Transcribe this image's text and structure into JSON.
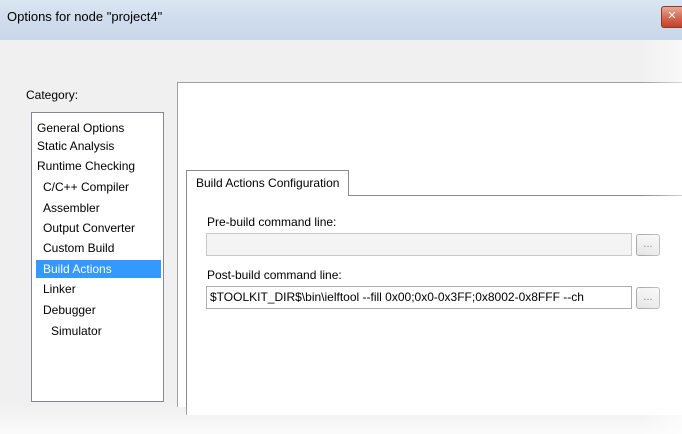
{
  "window": {
    "title": "Options for node \"project4\"",
    "close_glyph": "✕"
  },
  "category": {
    "label": "Category:",
    "items": [
      {
        "label": "General Options",
        "indent": 0
      },
      {
        "label": "Static Analysis",
        "indent": 0
      },
      {
        "label": "Runtime Checking",
        "indent": 0
      },
      {
        "label": "C/C++ Compiler",
        "indent": 1
      },
      {
        "label": "Assembler",
        "indent": 1
      },
      {
        "label": "Output Converter",
        "indent": 1
      },
      {
        "label": "Custom Build",
        "indent": 1
      },
      {
        "label": "Build Actions",
        "indent": 1,
        "selected": true
      },
      {
        "label": "Linker",
        "indent": 1
      },
      {
        "label": "Debugger",
        "indent": 1
      },
      {
        "label": "Simulator",
        "indent": 2
      }
    ],
    "selected_color": "#3399ff"
  },
  "tabs": [
    {
      "label": "Build Actions Configuration",
      "active": true
    }
  ],
  "pre_build": {
    "label": "Pre-build command line:",
    "value": "",
    "browse_label": "..."
  },
  "post_build": {
    "label": "Post-build command line:",
    "value": "$TOOLKIT_DIR$\\bin\\ielftool --fill 0x00;0x0-0x3FF;0x8002-0x8FFF --ch",
    "browse_label": "..."
  }
}
